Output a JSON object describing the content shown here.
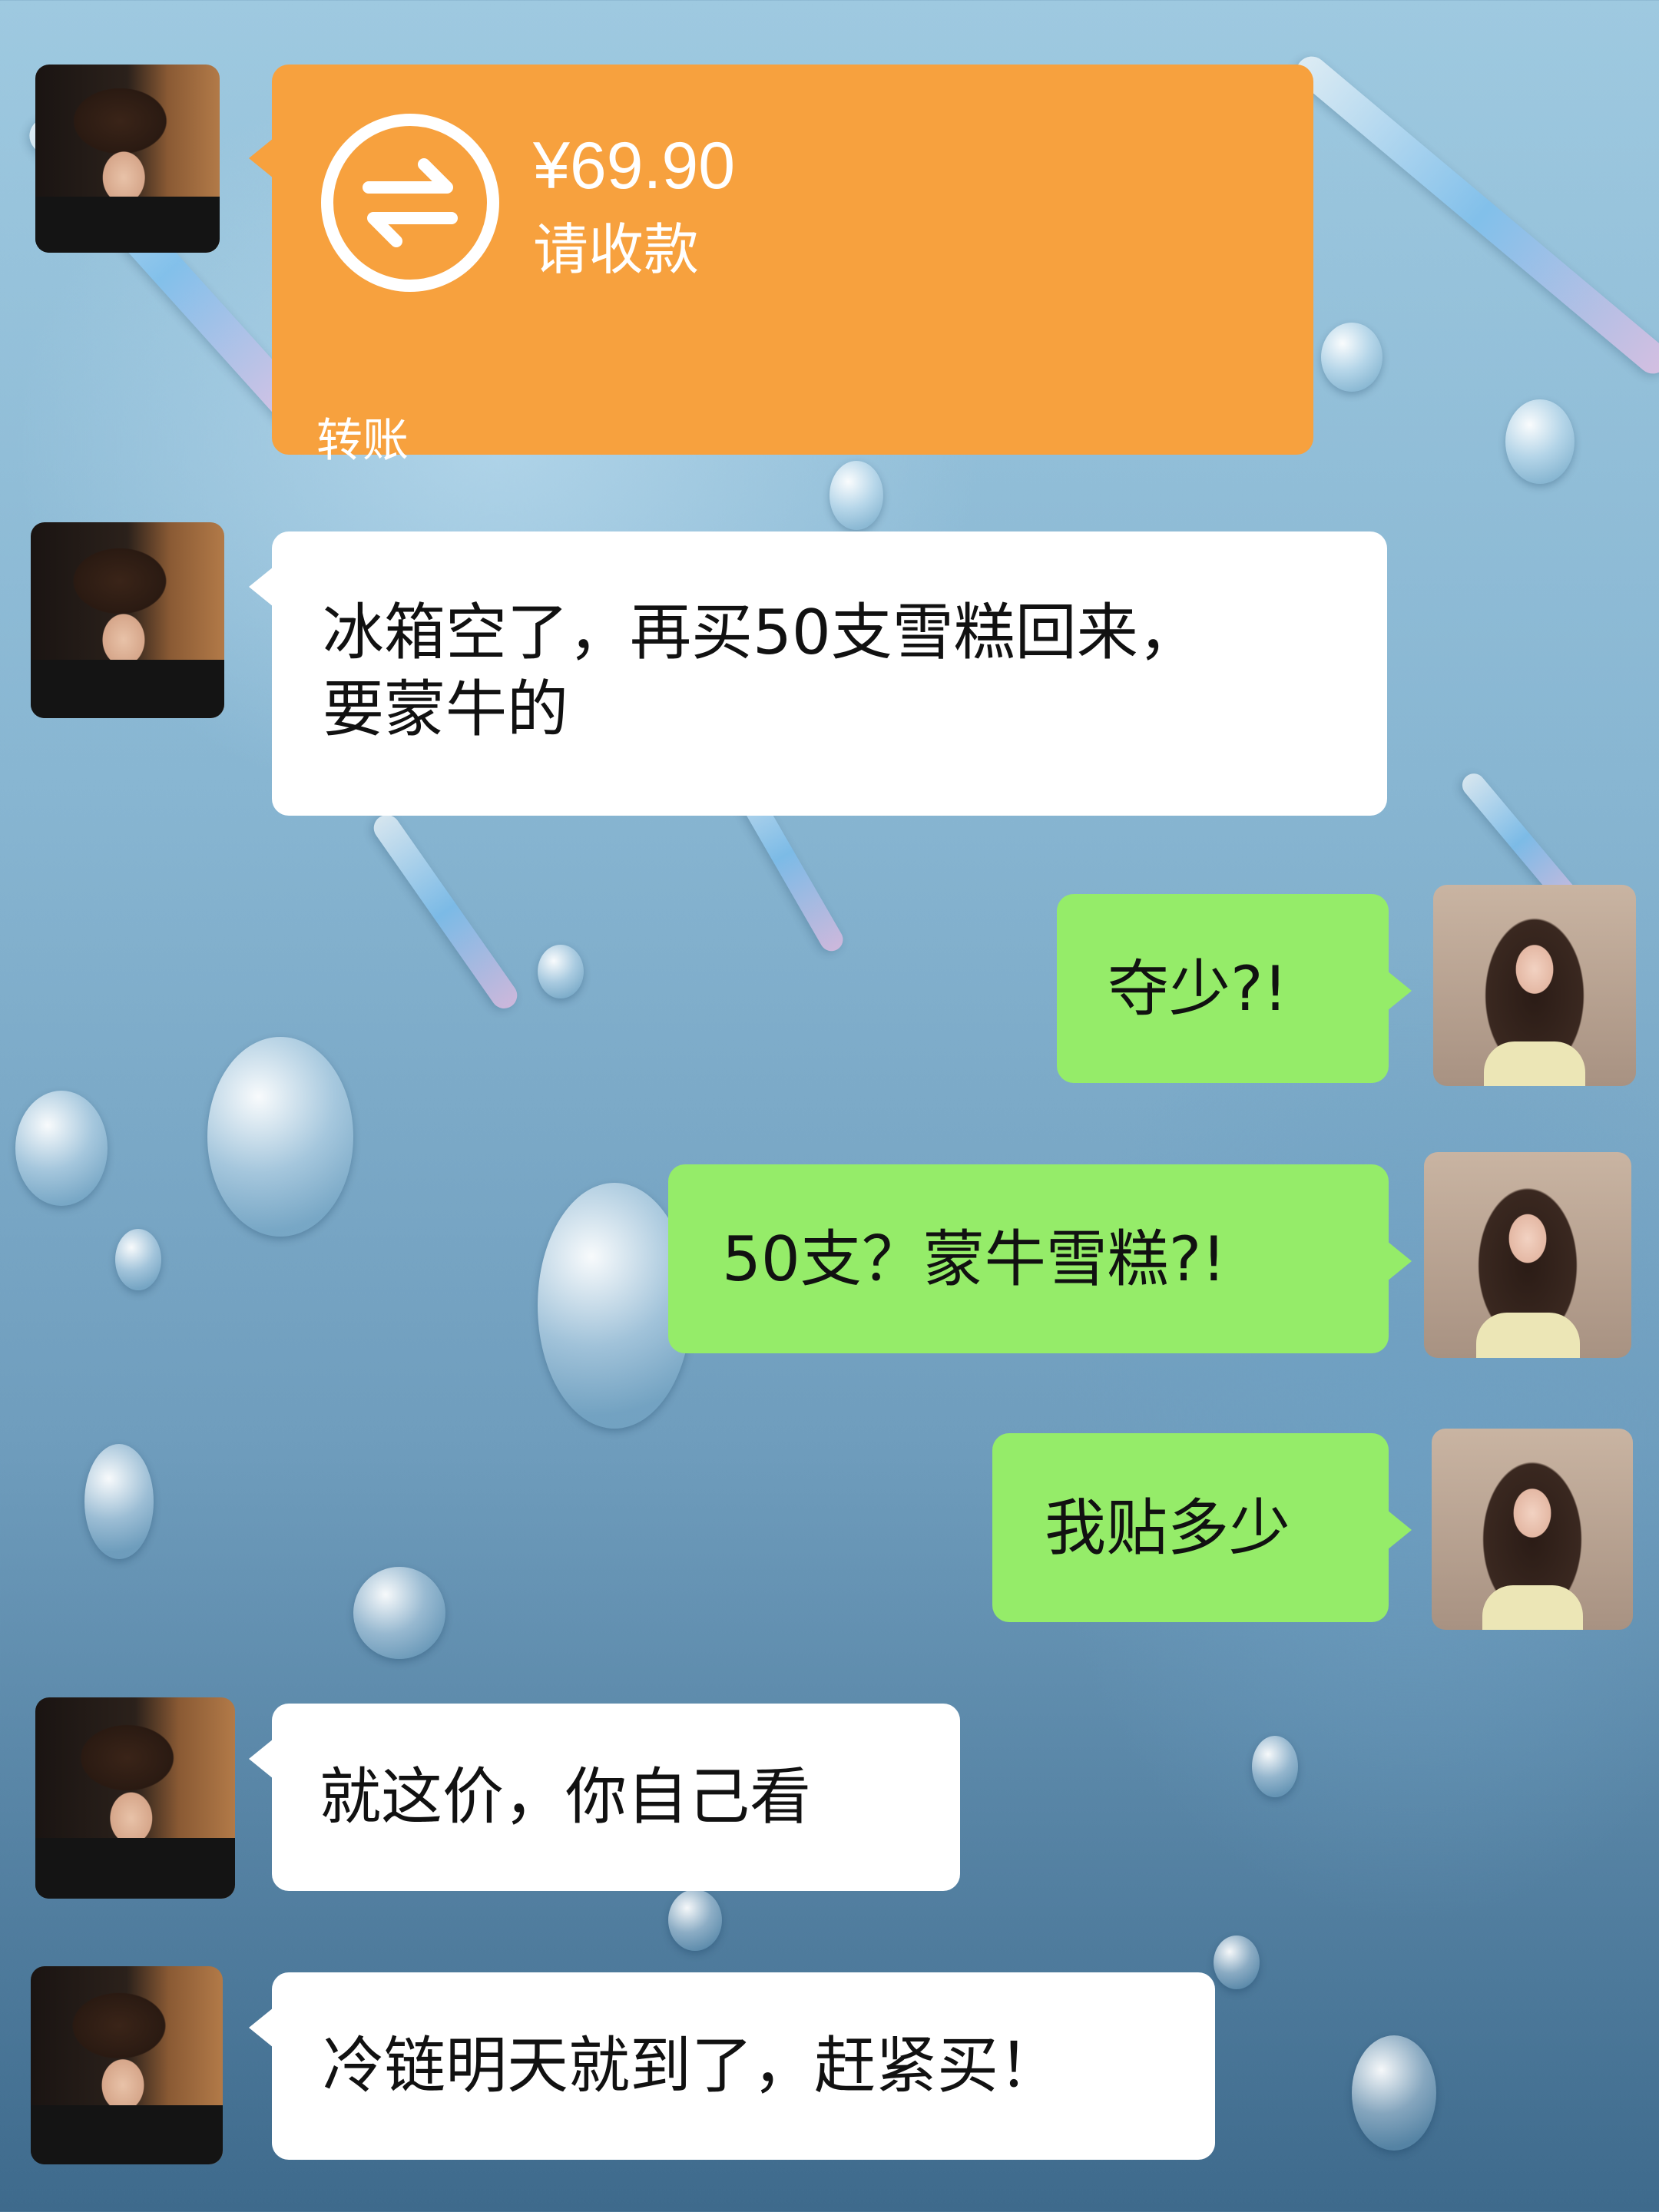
{
  "conversation": {
    "transfer": {
      "amount": "¥69.90",
      "note": "请收款",
      "label": "转账",
      "icon": "transfer-arrows-icon",
      "color": "#f7a13e"
    },
    "messages": [
      {
        "from": "other",
        "text": "冰箱空了，再买50支雪糕回来，\n要蒙牛的"
      },
      {
        "from": "self",
        "text": "夺少?!"
      },
      {
        "from": "self",
        "text": "50支？蒙牛雪糕?!"
      },
      {
        "from": "self",
        "text": "我贴多少"
      },
      {
        "from": "other",
        "text": "就这价，你自己看"
      },
      {
        "from": "other",
        "text": "冷链明天就到了，赶紧买！"
      }
    ]
  },
  "colors": {
    "self_bubble": "#95ec69",
    "other_bubble": "#ffffff"
  }
}
